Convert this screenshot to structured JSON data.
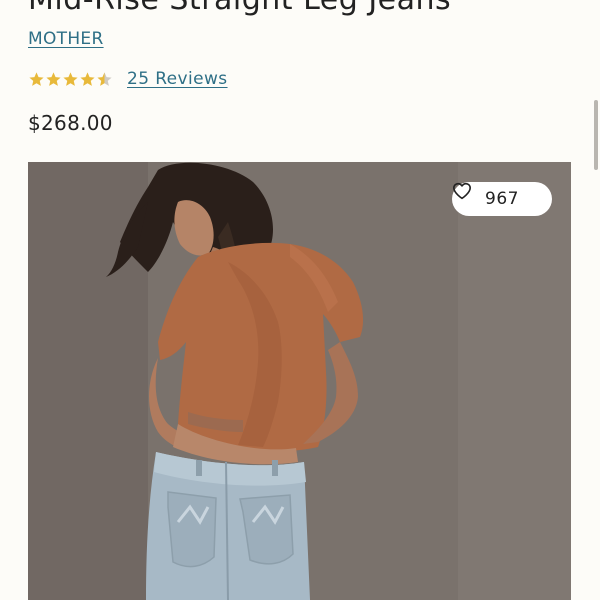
{
  "product": {
    "title": "Mid-Rise Straight Leg Jeans",
    "brand": "MOTHER",
    "rating": 4.5,
    "rating_max": 5,
    "reviews_label": "25 Reviews",
    "price": "$268.00"
  },
  "image": {
    "like_count": "967",
    "like_icon": "heart-outline-icon",
    "subject": "model wearing rust t-shirt and light wash jeans"
  },
  "colors": {
    "star": "#e8b93a",
    "star_empty": "#cfcac2",
    "link": "#2e6f86",
    "background": "#fdfcf8"
  }
}
